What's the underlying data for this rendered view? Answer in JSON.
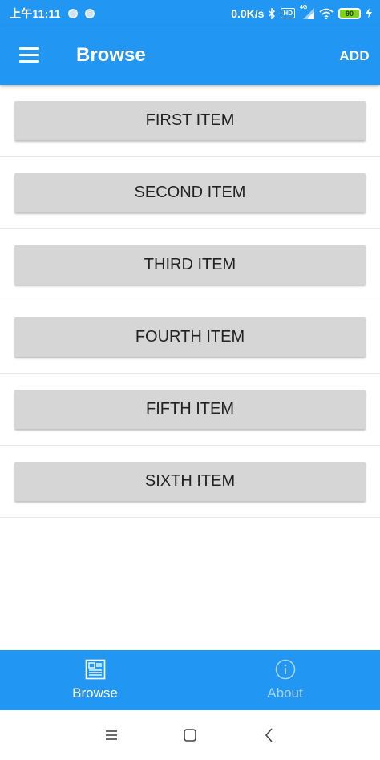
{
  "status_bar": {
    "time": "上午11:11",
    "network_speed": "0.0K/s",
    "hd_label": "HD",
    "signal_label": "4G",
    "battery_level": "90"
  },
  "app_bar": {
    "title": "Browse",
    "action_label": "ADD",
    "color": "#2196f3"
  },
  "items": [
    {
      "label": "FIRST ITEM"
    },
    {
      "label": "SECOND ITEM"
    },
    {
      "label": "THIRD ITEM"
    },
    {
      "label": "FOURTH ITEM"
    },
    {
      "label": "FIFTH ITEM"
    },
    {
      "label": "SIXTH ITEM"
    }
  ],
  "tabs": [
    {
      "label": "Browse",
      "icon": "newspaper-icon",
      "active": true
    },
    {
      "label": "About",
      "icon": "info-icon",
      "active": false
    }
  ],
  "system_nav": {
    "buttons": [
      "menu-icon",
      "home-icon",
      "back-icon"
    ]
  }
}
